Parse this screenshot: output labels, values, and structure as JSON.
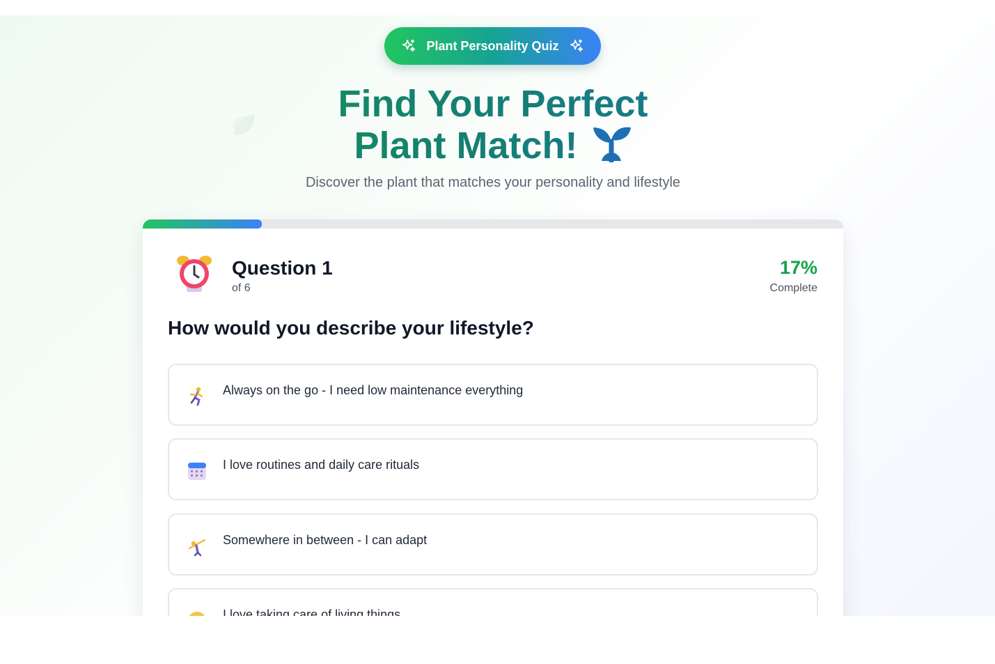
{
  "header": {
    "badge_label": "Plant Personality Quiz",
    "badge_icon_left": "sparkles-icon",
    "badge_icon_right": "sparkles-icon",
    "title_line1": "Find Your Perfect",
    "title_line2": "Plant Match!",
    "title_icon": "sprout-icon",
    "subtitle": "Discover the plant that matches your personality and lifestyle"
  },
  "progress": {
    "fraction": 0.17,
    "color_start": "#22c55e",
    "color_end": "#3b82f6"
  },
  "question_header": {
    "icon": "alarm-clock-icon",
    "title": "Question 1",
    "subtitle": "of 6",
    "percent": "17%",
    "percent_label": "Complete"
  },
  "question": {
    "text": "How would you describe your lifestyle?",
    "options": [
      {
        "icon": "running-person-icon",
        "label": "Always on the go - I need low maintenance everything"
      },
      {
        "icon": "calendar-icon",
        "label": "I love routines and daily care rituals"
      },
      {
        "icon": "cartwheel-person-icon",
        "label": "Somewhere in between - I can adapt"
      },
      {
        "icon": "hug-face-icon",
        "label": "I love taking care of living things"
      }
    ]
  },
  "colors": {
    "accent_green": "#16a34a",
    "accent_blue": "#3b82f6",
    "text_dark": "#111827",
    "border": "#e5e7eb"
  }
}
